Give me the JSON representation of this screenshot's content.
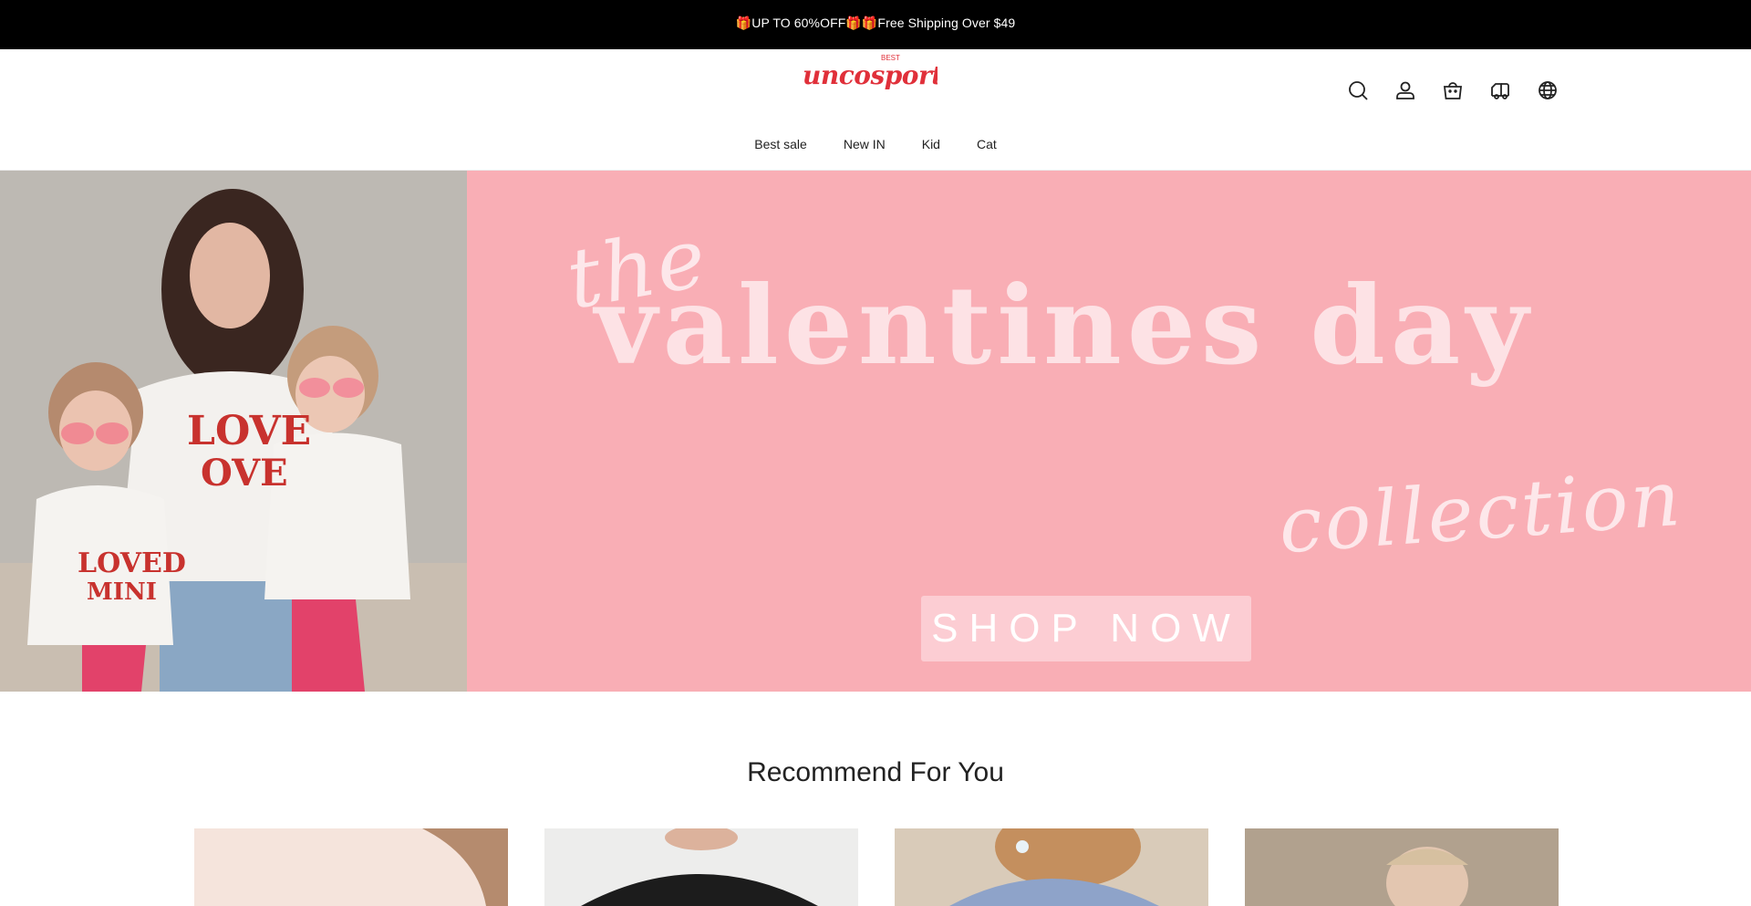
{
  "announcement": {
    "text": "🎁UP TO 60%OFF🎁🎁Free Shipping Over $49"
  },
  "brand": {
    "logo_text": "uncosports.",
    "logo_badge": "BEST",
    "color": "#e0303a"
  },
  "header_icons": [
    {
      "name": "search-icon"
    },
    {
      "name": "account-icon"
    },
    {
      "name": "cart-icon"
    },
    {
      "name": "track-order-icon"
    },
    {
      "name": "language-icon"
    }
  ],
  "nav": {
    "items": [
      {
        "label": "Best sale"
      },
      {
        "label": "New IN"
      },
      {
        "label": "Kid"
      },
      {
        "label": "Cat"
      }
    ]
  },
  "hero": {
    "script_the": "the",
    "title": "valentines day",
    "script_collection": "collection",
    "cta": "SHOP NOW",
    "bg_color": "#f9aeb5"
  },
  "recommend": {
    "title": "Recommend For You",
    "products": [
      {
        "name": "product-1"
      },
      {
        "name": "product-2"
      },
      {
        "name": "product-3"
      },
      {
        "name": "product-4"
      }
    ]
  }
}
